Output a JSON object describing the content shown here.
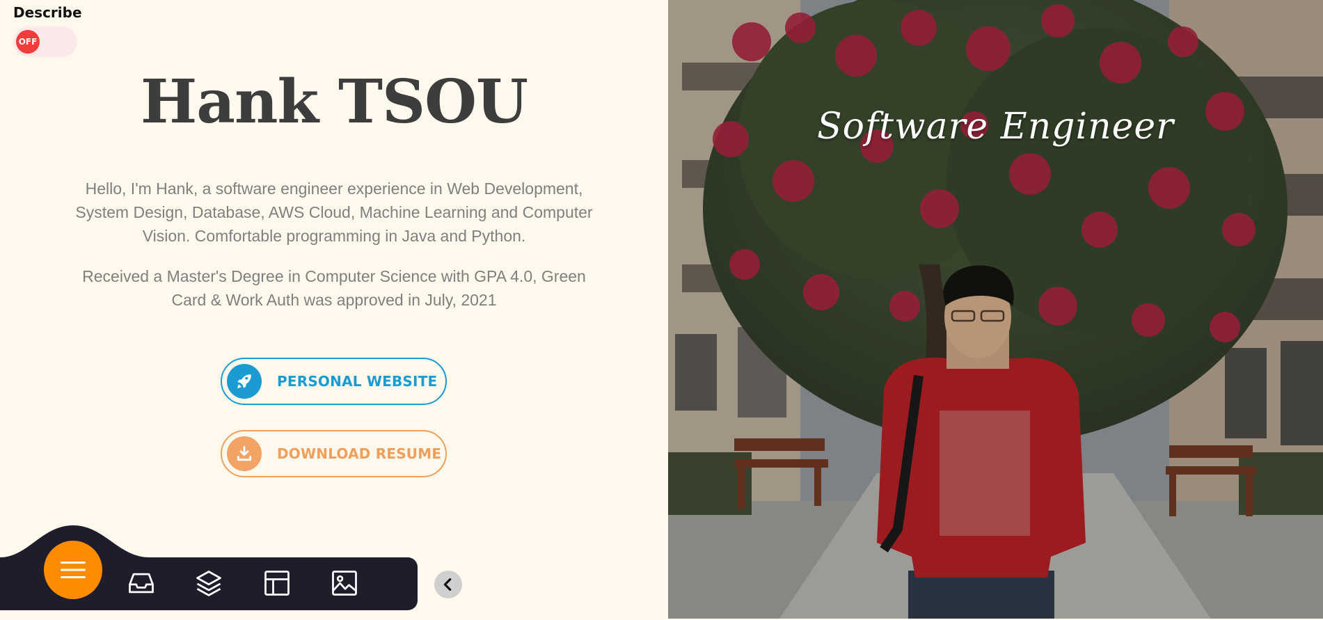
{
  "describe": {
    "label": "Describe",
    "toggle_state": "OFF"
  },
  "profile": {
    "name": "Hank TSOU",
    "bio1": "Hello, I'm Hank, a software engineer experience in Web Development, System Design, Database, AWS Cloud, Machine Learning and Computer Vision. Comfortable programming in Java and Python.",
    "bio2": "Received a Master's Degree in Computer Science with GPA 4.0, Green Card & Work Auth was approved in July, 2021"
  },
  "buttons": {
    "website": {
      "label": "PERSONAL WEBSITE",
      "icon": "rocket-icon",
      "color": "#1a9bd2"
    },
    "resume": {
      "label": "DOWNLOAD RESUME",
      "icon": "download-icon",
      "color": "#ef9f5a"
    }
  },
  "dock": {
    "menu_icon": "hamburger-icon",
    "items": [
      {
        "icon": "inbox-icon"
      },
      {
        "icon": "layers-icon"
      },
      {
        "icon": "layout-icon"
      },
      {
        "icon": "image-icon"
      }
    ],
    "collapse_icon": "chevron-left-icon",
    "accent": "#ff8c00",
    "background": "#1f1d2c"
  },
  "hero": {
    "tagline": "Software Engineer"
  }
}
